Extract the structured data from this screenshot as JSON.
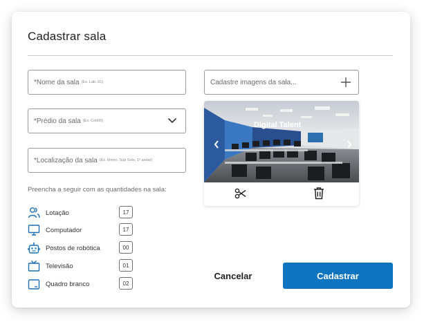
{
  "modal": {
    "title": "Cadastrar sala"
  },
  "form": {
    "name": {
      "label": "*Nome da sala",
      "hint": "(Ex. Lab. 01)"
    },
    "building": {
      "label": "*Prédio da sala",
      "hint": "(Ex. Coti00)"
    },
    "location": {
      "label": "*Localização da sala",
      "hint": "(Ex. térreo, Sub Solo, 1º andar)"
    },
    "quantities_intro": "Preencha a seguir com as quantidades na sala:",
    "quantities": [
      {
        "label": "Lotação",
        "value": "17",
        "icon": "people-icon"
      },
      {
        "label": "Computador",
        "value": "17",
        "icon": "monitor-icon"
      },
      {
        "label": "Postos de robótica",
        "value": "00",
        "icon": "robot-icon"
      },
      {
        "label": "Televisão",
        "value": "01",
        "icon": "tv-icon"
      },
      {
        "label": "Quadro branco",
        "value": "02",
        "icon": "whiteboard-icon"
      }
    ]
  },
  "images": {
    "placeholder": "Cadastre imagens da sala...",
    "photo_sign": "Digital Talent",
    "actions": {
      "cut": "scissors-icon",
      "delete": "trash-icon"
    }
  },
  "actions": {
    "cancel": "Cancelar",
    "submit": "Cadastrar"
  },
  "colors": {
    "accent": "#0f74c0",
    "icon": "#1a6fb5"
  }
}
